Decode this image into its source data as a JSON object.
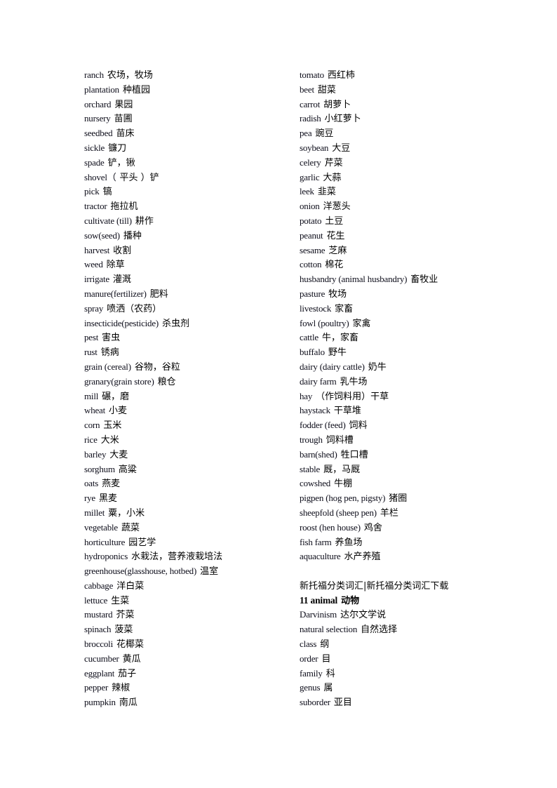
{
  "document": {
    "left_column": [
      {
        "en": "ranch",
        "zh": "农场，牧场"
      },
      {
        "en": "plantation",
        "zh": "种植园"
      },
      {
        "en": "orchard",
        "zh": "果园"
      },
      {
        "en": "nursery",
        "zh": "苗圃"
      },
      {
        "en": "seedbed",
        "zh": "苗床"
      },
      {
        "en": "sickle",
        "zh": "镰刀"
      },
      {
        "en": "spade",
        "zh": "铲，锹"
      },
      {
        "en": "shovel（",
        "zh": "平头 ）铲"
      },
      {
        "en": "pick",
        "zh": "镐"
      },
      {
        "en": "tractor",
        "zh": "拖拉机"
      },
      {
        "en": "cultivate (till)",
        "zh": "耕作"
      },
      {
        "en": "sow(seed)",
        "zh": "播种"
      },
      {
        "en": "harvest",
        "zh": "收割"
      },
      {
        "en": "weed",
        "zh": "除草"
      },
      {
        "en": "irrigate",
        "zh": "灌溉"
      },
      {
        "en": "manure(fertilizer)",
        "zh": "肥料"
      },
      {
        "en": "spray",
        "zh": "喷洒（农药）"
      },
      {
        "en": "insecticide(pesticide)",
        "zh": "杀虫剂"
      },
      {
        "en": "pest",
        "zh": "害虫"
      },
      {
        "en": "rust",
        "zh": "锈病"
      },
      {
        "en": "grain (cereal)",
        "zh": "谷物，谷粒"
      },
      {
        "en": "granary(grain store)",
        "zh": "粮仓"
      },
      {
        "en": "mill",
        "zh": "碾，磨"
      },
      {
        "en": "wheat",
        "zh": "小麦"
      },
      {
        "en": "corn",
        "zh": "玉米"
      },
      {
        "en": "rice",
        "zh": "大米"
      },
      {
        "en": "barley",
        "zh": "大麦"
      },
      {
        "en": "sorghum",
        "zh": "高粱"
      },
      {
        "en": "oats",
        "zh": "燕麦"
      },
      {
        "en": "rye",
        "zh": "黑麦"
      },
      {
        "en": "millet",
        "zh": "粟，小米"
      },
      {
        "en": "vegetable",
        "zh": "蔬菜"
      },
      {
        "en": "horticulture",
        "zh": "园艺学"
      },
      {
        "en": "hydroponics",
        "zh": "水栽法，营养液栽培法"
      },
      {
        "en": "greenhouse(glasshouse, hotbed)",
        "zh": "温室"
      },
      {
        "en": "cabbage",
        "zh": "洋白菜"
      },
      {
        "en": "lettuce",
        "zh": "生菜"
      },
      {
        "en": "mustard",
        "zh": "芥菜"
      },
      {
        "en": "spinach",
        "zh": "菠菜"
      },
      {
        "en": "broccoli",
        "zh": "花椰菜"
      },
      {
        "en": "cucumber",
        "zh": "黄瓜"
      },
      {
        "en": "eggplant",
        "zh": "茄子"
      },
      {
        "en": "pepper",
        "zh": "辣椒"
      },
      {
        "en": "pumpkin",
        "zh": "南瓜"
      }
    ],
    "right_column": [
      {
        "en": "tomato",
        "zh": "西红柿"
      },
      {
        "en": "beet",
        "zh": "甜菜"
      },
      {
        "en": "carrot",
        "zh": "胡萝卜"
      },
      {
        "en": "radish",
        "zh": "小红萝卜"
      },
      {
        "en": "pea",
        "zh": "豌豆"
      },
      {
        "en": "soybean",
        "zh": "大豆"
      },
      {
        "en": "celery",
        "zh": "芹菜"
      },
      {
        "en": "garlic",
        "zh": "大蒜"
      },
      {
        "en": "leek",
        "zh": "韭菜"
      },
      {
        "en": "onion",
        "zh": "洋葱头"
      },
      {
        "en": "potato",
        "zh": "土豆"
      },
      {
        "en": "peanut",
        "zh": "花生"
      },
      {
        "en": "sesame",
        "zh": "芝麻"
      },
      {
        "en": "cotton",
        "zh": "棉花"
      },
      {
        "en": "husbandry (animal husbandry)",
        "zh": "畜牧业"
      },
      {
        "en": "pasture",
        "zh": "牧场"
      },
      {
        "en": "livestock",
        "zh": "家畜"
      },
      {
        "en": "fowl (poultry)",
        "zh": "家禽"
      },
      {
        "en": "cattle",
        "zh": "牛，家畜"
      },
      {
        "en": "buffalo",
        "zh": "野牛"
      },
      {
        "en": "dairy (dairy cattle)",
        "zh": "奶牛"
      },
      {
        "en": "dairy farm",
        "zh": "乳牛场"
      },
      {
        "en": "hay",
        "zh": "（作饲料用）干草"
      },
      {
        "en": "haystack",
        "zh": "干草堆"
      },
      {
        "en": "fodder (feed)",
        "zh": "饲料"
      },
      {
        "en": "trough",
        "zh": "饲料槽"
      },
      {
        "en": "barn(shed)",
        "zh": "牲口槽"
      },
      {
        "en": "stable",
        "zh": "厩，马厩"
      },
      {
        "en": "cowshed",
        "zh": "牛棚"
      },
      {
        "en": "pigpen (hog pen, pigsty)",
        "zh": "猪圈"
      },
      {
        "en": "sheepfold (sheep pen)",
        "zh": "羊栏"
      },
      {
        "en": "roost (hen house)",
        "zh": "鸡舍"
      },
      {
        "en": "fish farm",
        "zh": "养鱼场"
      },
      {
        "en": "aquaculture",
        "zh": "水产养殖"
      }
    ],
    "banner": "新托福分类词汇|新托福分类词汇下载",
    "section": {
      "en": "11 animal",
      "zh": "动物"
    },
    "right_column_2": [
      {
        "en": "Darvinism",
        "zh": "达尔文学说"
      },
      {
        "en": "natural selection",
        "zh": "自然选择"
      },
      {
        "en": "class",
        "zh": "纲"
      },
      {
        "en": "order",
        "zh": "目"
      },
      {
        "en": "family",
        "zh": "科"
      },
      {
        "en": "genus",
        "zh": "属"
      },
      {
        "en": "suborder",
        "zh": "亚目"
      }
    ]
  }
}
